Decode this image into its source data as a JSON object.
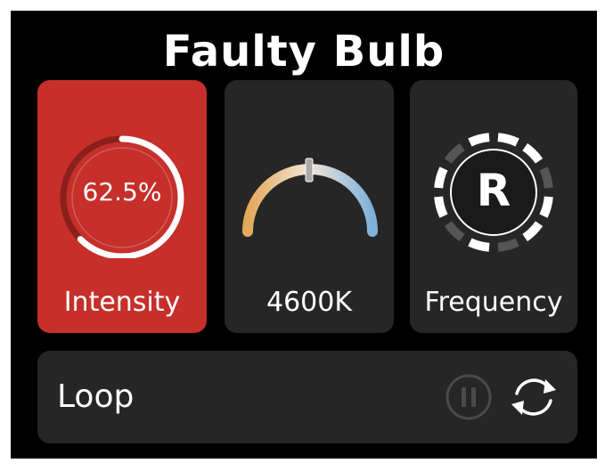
{
  "title": "Faulty Bulb",
  "cards": {
    "intensity": {
      "label": "Intensity",
      "value_text": "62.5%",
      "fraction": 0.625,
      "active": true
    },
    "temperature": {
      "label": "4600K"
    },
    "frequency": {
      "label": "Frequency",
      "letter": "R"
    }
  },
  "loop": {
    "label": "Loop",
    "pause_icon": "pause-icon",
    "cycle_icon": "loop-arrows-icon"
  },
  "colors": {
    "active_card": "#c62f2a",
    "card": "#262626",
    "background": "#000000",
    "warm": "#e3a85a",
    "cool": "#7fb0d8"
  }
}
